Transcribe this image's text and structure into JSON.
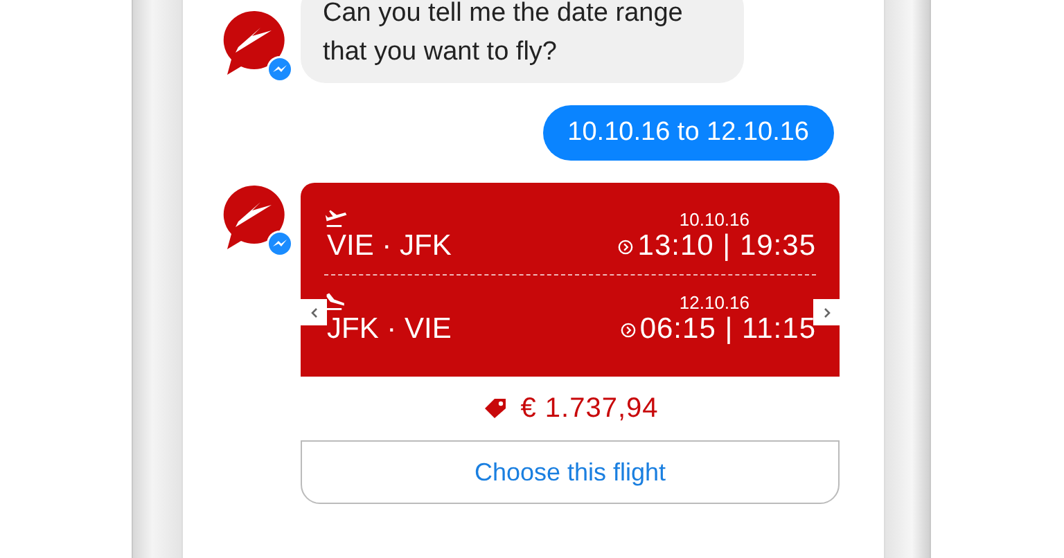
{
  "messages": [
    {
      "kind": "incoming",
      "text": "Can you tell me the date range that you want to fly?"
    },
    {
      "kind": "outgoing",
      "text": "10.10.16 to 12.10.16"
    },
    {
      "kind": "flight_card",
      "legs": [
        {
          "kind": "departure",
          "date": "10.10.16",
          "route": "VIE · JFK",
          "times": "13:10 | 19:35"
        },
        {
          "kind": "arrival",
          "date": "12.10.16",
          "route": "JFK · VIE",
          "times": "06:15 | 11:15"
        }
      ],
      "price": "€ 1.737,94",
      "button": "Choose this flight"
    }
  ]
}
